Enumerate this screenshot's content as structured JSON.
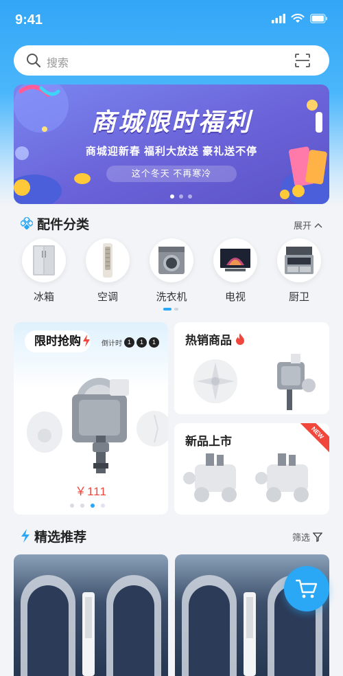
{
  "status_bar": {
    "time": "9:41"
  },
  "search": {
    "placeholder": "搜索"
  },
  "banner": {
    "title": "商城限时福利",
    "subtitle": "商城迎新春 福利大放送 豪礼送不停",
    "pill": "这个冬天 不再寒冷"
  },
  "categories_section": {
    "title": "配件分类",
    "action": "展开",
    "items": [
      {
        "label": "冰箱",
        "icon": "fridge-icon"
      },
      {
        "label": "空调",
        "icon": "air-conditioner-icon"
      },
      {
        "label": "洗衣机",
        "icon": "washing-machine-icon"
      },
      {
        "label": "电视",
        "icon": "tv-icon"
      },
      {
        "label": "厨卫",
        "icon": "kitchen-icon"
      }
    ]
  },
  "flash_sale": {
    "title": "限时抢购",
    "countdown_label": "倒计时",
    "countdown": [
      "1",
      "1",
      "1"
    ],
    "price": "￥111"
  },
  "hot_products": {
    "title": "热销商品"
  },
  "new_products": {
    "title": "新品上市",
    "badge": "NEW"
  },
  "recommend_section": {
    "title": "精选推荐",
    "action": "筛选"
  },
  "colors": {
    "accent": "#2aa7f5",
    "price": "#f0463c",
    "banner": "#6a62d8"
  }
}
